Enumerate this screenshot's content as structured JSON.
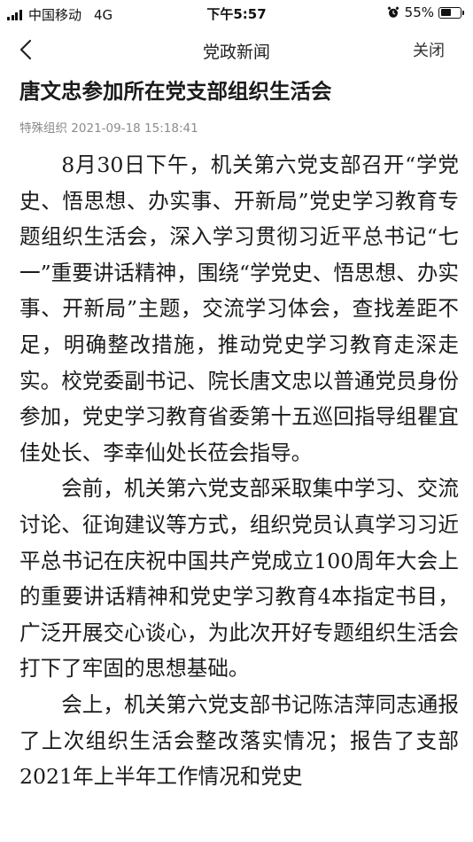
{
  "status_bar": {
    "carrier": "中国移动",
    "network": "4G",
    "time": "下午5:57",
    "battery_percent": "55%",
    "battery_level": 0.55,
    "icons": [
      "signal-icon",
      "alarm-icon",
      "battery-icon"
    ]
  },
  "nav": {
    "back_icon": "chevron-left-icon",
    "title": "党政新闻",
    "close_label": "关闭"
  },
  "article": {
    "title": "唐文忠参加所在党支部组织生活会",
    "source": "特殊组织",
    "datetime": "2021-09-18 15:18:41",
    "paragraphs": [
      "8月30日下午，机关第六党支部召开“学党史、悟思想、办实事、开新局”党史学习教育专题组织生活会，深入学习贯彻习近平总书记“七一”重要讲话精神，围绕“学党史、悟思想、办实事、开新局”主题，交流学习体会，查找差距不足，明确整改措施，推动党史学习教育走深走实。校党委副书记、院长唐文忠以普通党员身份参加，党史学习教育省委第十五巡回指导组瞿宜佳处长、李幸仙处长莅会指导。",
      "会前，机关第六党支部采取集中学习、交流讨论、征询建议等方式，组织党员认真学习习近平总书记在庆祝中国共产党成立100周年大会上的重要讲话精神和党史学习教育4本指定书目，广泛开展交心谈心，为此次开好专题组织生活会打下了牢固的思想基础。",
      "会上，机关第六党支部书记陈洁萍同志通报了上次组织生活会整改落实情况；报告了支部2021年上半年工作情况和党史"
    ]
  }
}
